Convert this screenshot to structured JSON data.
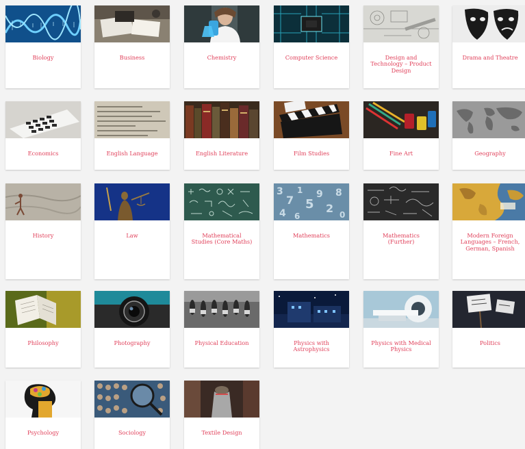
{
  "subjects": [
    {
      "name": "Biology",
      "image": "dna-helix"
    },
    {
      "name": "Business",
      "image": "office-desk"
    },
    {
      "name": "Chemistry",
      "image": "scientist-flask"
    },
    {
      "name": "Computer Science",
      "image": "circuit-board"
    },
    {
      "name": "Design and Technology – Product Design",
      "image": "technical-drawing"
    },
    {
      "name": "Drama and Theatre",
      "image": "theatre-masks"
    },
    {
      "name": "Economics",
      "image": "calculator"
    },
    {
      "name": "English Language",
      "image": "dictionary-text"
    },
    {
      "name": "English Literature",
      "image": "old-books"
    },
    {
      "name": "Film Studies",
      "image": "clapperboard"
    },
    {
      "name": "Fine Art",
      "image": "paint-supplies"
    },
    {
      "name": "Geography",
      "image": "world-map"
    },
    {
      "name": "History",
      "image": "cave-painting"
    },
    {
      "name": "Law",
      "image": "lady-justice"
    },
    {
      "name": "Mathematical Studies (Core Maths)",
      "image": "chalkboard-equations"
    },
    {
      "name": "Mathematics",
      "image": "3d-numbers"
    },
    {
      "name": "Mathematics (Further)",
      "image": "blackboard-formulas"
    },
    {
      "name": "Modern Foreign Languages – French, German, Spanish",
      "image": "globe-map"
    },
    {
      "name": "Philosophy",
      "image": "open-book"
    },
    {
      "name": "Photography",
      "image": "camera-lens"
    },
    {
      "name": "Physical Education",
      "image": "runners"
    },
    {
      "name": "Physics with Astrophysics",
      "image": "observatory"
    },
    {
      "name": "Physics with Medical Physics",
      "image": "mri-scanner"
    },
    {
      "name": "Politics",
      "image": "protest-signs"
    },
    {
      "name": "Psychology",
      "image": "brain-head"
    },
    {
      "name": "Sociology",
      "image": "crowd-magnifier"
    },
    {
      "name": "Textile Design",
      "image": "dress-mannequin"
    }
  ]
}
